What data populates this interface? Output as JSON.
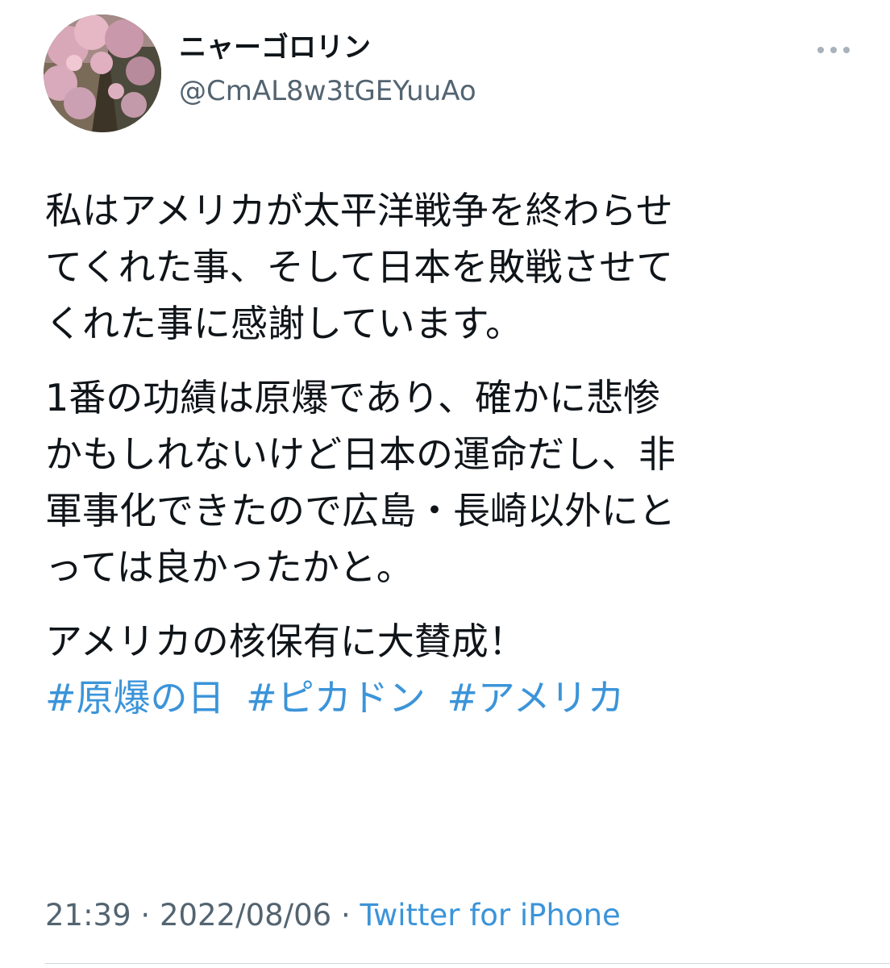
{
  "author": {
    "display_name": "ニャーゴロリン",
    "handle": "@CmAL8w3tGEYuuAo",
    "avatar_icon": "cherry-blossom-photo"
  },
  "more_icon": "more-dots-icon",
  "tweet": {
    "paragraphs": [
      [
        "私はアメリカが太平洋戦争を終わらせ",
        "てくれた事、そして日本を敗戦させて",
        "くれた事に感謝しています。"
      ],
      [
        "1番の功績は原爆であり、確かに悲惨",
        "かもしれないけど日本の運命だし、非",
        "軍事化できたので広島・長崎以外にと",
        "っては良かったかと。"
      ],
      [
        "アメリカの核保有に大賛成！"
      ]
    ],
    "hashtags": [
      "#原爆の日",
      "#ピカドン",
      "#アメリカ"
    ]
  },
  "meta": {
    "time": "21:39",
    "separator": "·",
    "date": "2022/08/06",
    "source": "Twitter for iPhone"
  },
  "colors": {
    "link": "#3b94d9",
    "secondary_text": "#536471",
    "primary_text": "#0f1419"
  }
}
